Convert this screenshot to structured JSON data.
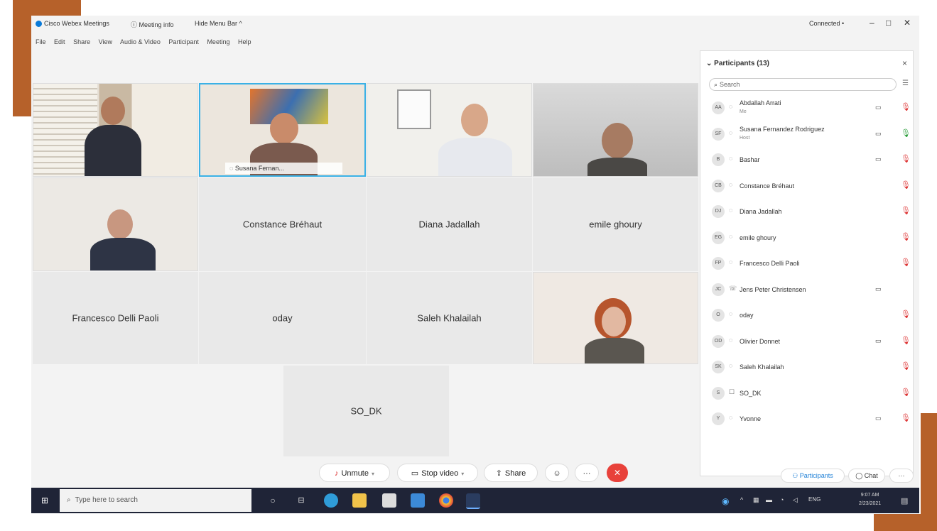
{
  "window": {
    "app_title": "Cisco Webex Meetings",
    "meeting_info": "Meeting info",
    "hide_menu_bar": "Hide Menu Bar ^",
    "connection": "Connected •",
    "minimize": "–",
    "maximize": "□",
    "close": "✕"
  },
  "menu": [
    "File",
    "Edit",
    "Share",
    "View",
    "Audio & Video",
    "Participant",
    "Meeting",
    "Help"
  ],
  "tiles": {
    "active_speaker_tag": "Susana Fernan...",
    "constance": "Constance Bréhaut",
    "diana": "Diana Jadallah",
    "emile": "emile ghoury",
    "francesco": "Francesco Delli Paoli",
    "oday": "oday",
    "saleh": "Saleh Khalailah",
    "sodk": "SO_DK"
  },
  "panel": {
    "title": "Participants (13)",
    "close": "×",
    "search_placeholder": "Search",
    "participants": [
      {
        "initials": "AA",
        "name": "Abdallah Arrati",
        "role": "Me",
        "device": "◌",
        "camera": "▭",
        "mic": "muted"
      },
      {
        "initials": "SF",
        "name": "Susana Fernandez Rodriguez",
        "role": "Host",
        "device": "◌",
        "camera": "▭",
        "mic": "on"
      },
      {
        "initials": "B",
        "name": "Bashar",
        "role": "",
        "device": "◌",
        "camera": "▭",
        "mic": "muted"
      },
      {
        "initials": "CB",
        "name": "Constance Bréhaut",
        "role": "",
        "device": "◌",
        "camera": "",
        "mic": "muted"
      },
      {
        "initials": "DJ",
        "name": "Diana Jadallah",
        "role": "",
        "device": "◌",
        "camera": "",
        "mic": "muted"
      },
      {
        "initials": "EG",
        "name": "emile ghoury",
        "role": "",
        "device": "◌",
        "camera": "",
        "mic": "muted"
      },
      {
        "initials": "FP",
        "name": "Francesco Delli Paoli",
        "role": "",
        "device": "◌",
        "camera": "",
        "mic": "muted"
      },
      {
        "initials": "JC",
        "name": "Jens Peter Christensen",
        "role": "",
        "device": "☏",
        "camera": "▭",
        "mic": "none"
      },
      {
        "initials": "O",
        "name": "oday",
        "role": "",
        "device": "◌",
        "camera": "",
        "mic": "muted"
      },
      {
        "initials": "OD",
        "name": "Olivier Donnet",
        "role": "",
        "device": "◌",
        "camera": "▭",
        "mic": "muted"
      },
      {
        "initials": "SK",
        "name": "Saleh Khalailah",
        "role": "",
        "device": "◌",
        "camera": "",
        "mic": "muted"
      },
      {
        "initials": "S",
        "name": "SO_DK",
        "role": "",
        "device": "☐",
        "camera": "",
        "mic": "muted"
      },
      {
        "initials": "Y",
        "name": "Yvonne",
        "role": "",
        "device": "◌",
        "camera": "▭",
        "mic": "muted"
      }
    ]
  },
  "controls": {
    "unmute": "Unmute",
    "stop_video": "Stop video",
    "share": "Share",
    "leave": "✕",
    "participants": "Participants",
    "chat": "Chat",
    "more": "···"
  },
  "taskbar": {
    "search_placeholder": "Type here to search",
    "language": "ENG",
    "time": "9:07 AM",
    "date": "2/23/2021"
  },
  "colors": {
    "accent": "#b6612a",
    "taskbar": "#1f2437",
    "leave": "#e8413a",
    "muted": "#d33333",
    "active_speaker": "#3ab1e6"
  }
}
